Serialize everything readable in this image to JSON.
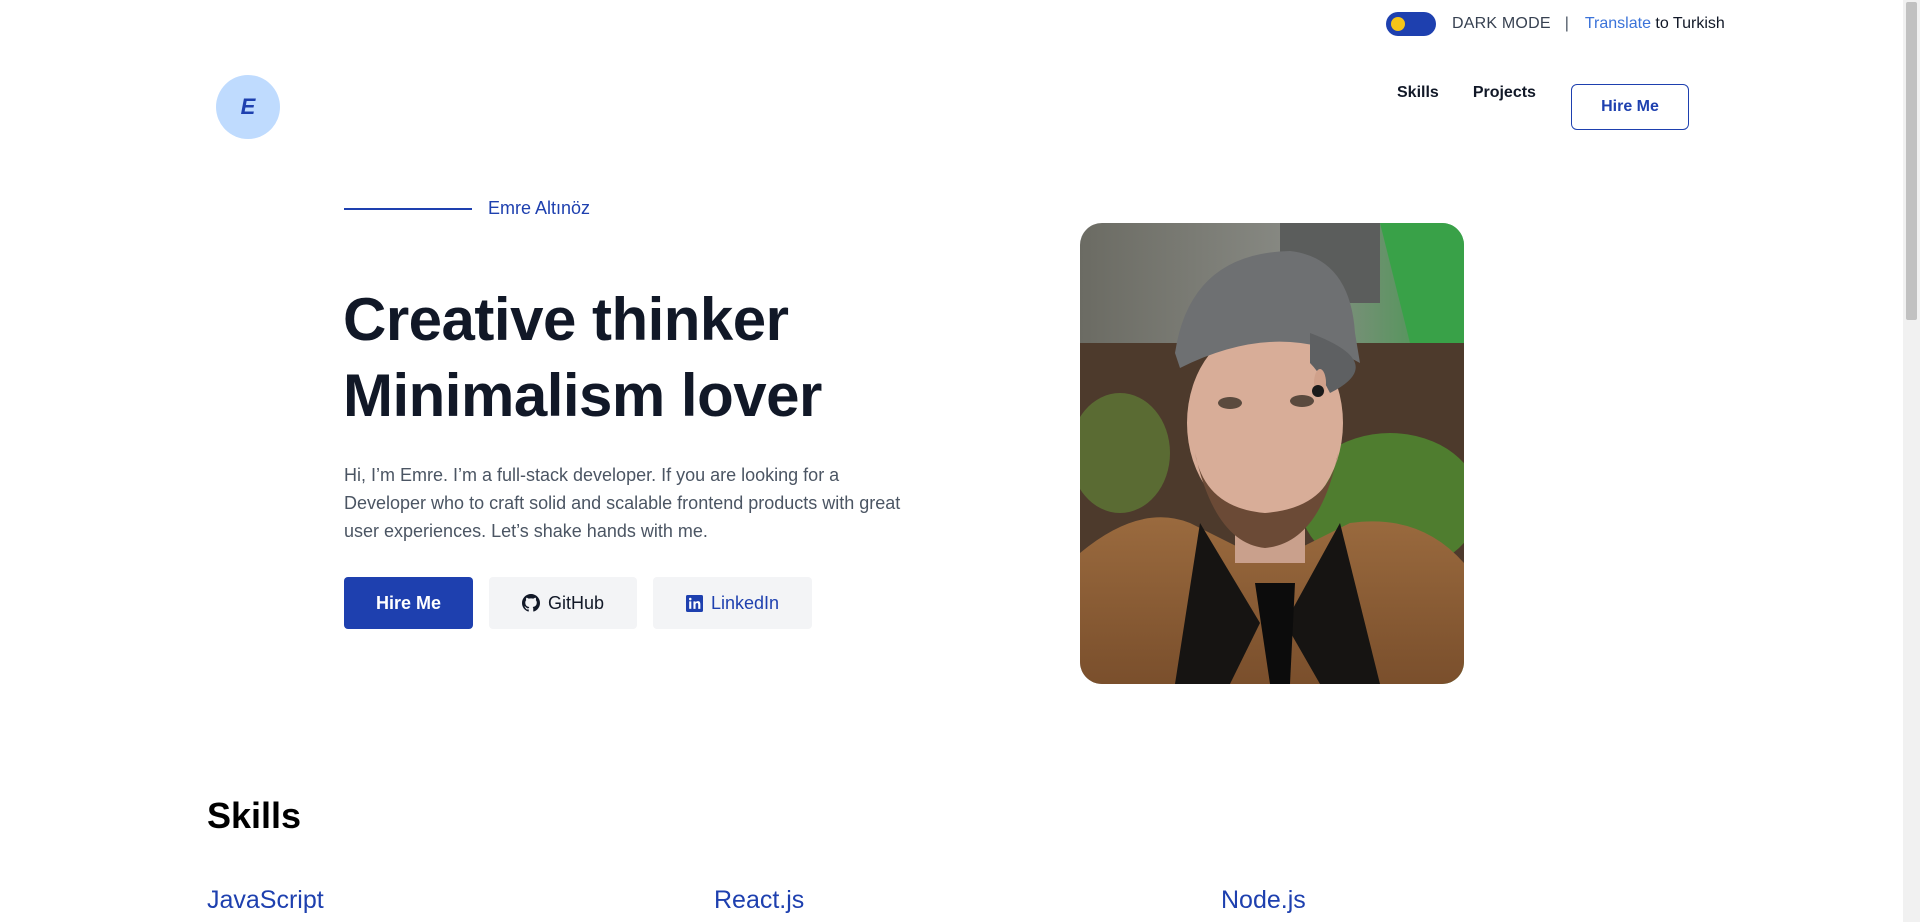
{
  "topbar": {
    "dark_mode_label": "DARK MODE",
    "separator": "|",
    "translate_link": "Translate",
    "translate_rest": " to Turkish"
  },
  "header": {
    "logo_letter": "E",
    "nav": {
      "skills": "Skills",
      "projects": "Projects",
      "hire_me": "Hire Me"
    }
  },
  "hero": {
    "eyebrow_name": "Emre Altınöz",
    "headline_line1": "Creative thinker",
    "headline_line2": "Minimalism lover",
    "intro": "Hi, I’m Emre. I’m a full-stack developer. If you are looking for a Developer who to craft solid and scalable frontend products with great user experiences. Let’s shake hands with me.",
    "buttons": {
      "hire_me": "Hire Me",
      "github": "GitHub",
      "linkedin": "LinkedIn"
    }
  },
  "skills": {
    "title": "Skills",
    "items": [
      "JavaScript",
      "React.js",
      "Node.js"
    ]
  },
  "colors": {
    "accent": "#1e40af",
    "logo_bg": "#bfdbfe",
    "toggle_knob": "#f5c518",
    "button_bg": "#f3f4f6"
  },
  "icons": {
    "theme_toggle": "toggle-switch",
    "github": "github-icon",
    "linkedin": "linkedin-icon"
  }
}
